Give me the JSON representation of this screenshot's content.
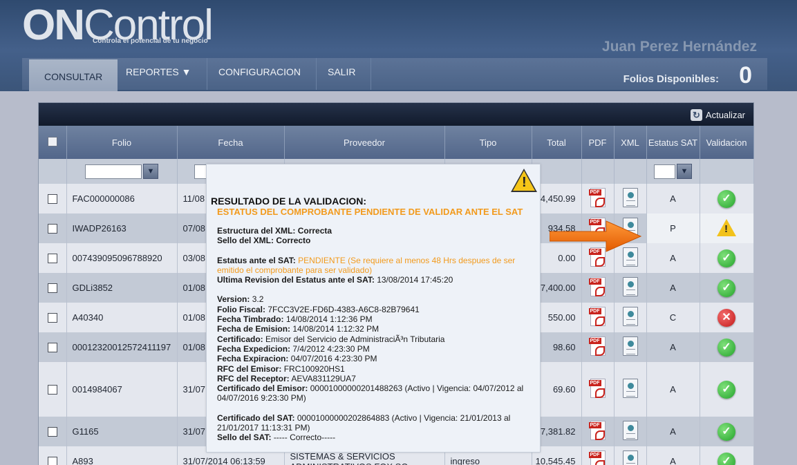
{
  "header": {
    "logo_on": "ON",
    "logo_control": "Control",
    "logo_tagline": "Controla el potencial de tu negocio",
    "user_name": "Juan Perez Hernández",
    "folios_label": "Folios Disponibles:",
    "folios_value": "0"
  },
  "nav": [
    {
      "label": "CONSULTAR"
    },
    {
      "label": "REPORTES ▼"
    },
    {
      "label": "CONFIGURACION"
    },
    {
      "label": "SALIR"
    }
  ],
  "toolbar": {
    "refresh_label": "Actualizar"
  },
  "table": {
    "columns": [
      "Folio",
      "Fecha",
      "Proveedor",
      "Tipo",
      "Total",
      "PDF",
      "XML",
      "Estatus SAT",
      "Validacion"
    ],
    "rows": [
      {
        "folio": "FAC000000086",
        "fecha": "11/08",
        "proveedor": "",
        "tipo": "",
        "total": "4,450.99",
        "estatus": "A",
        "validacion": "ok"
      },
      {
        "folio": "IWADP26163",
        "fecha": "07/08",
        "proveedor": "",
        "tipo": "",
        "total": "934.58",
        "estatus": "P",
        "validacion": "warn"
      },
      {
        "folio": "007439095096788920",
        "fecha": "03/08",
        "proveedor": "",
        "tipo": "",
        "total": "0.00",
        "estatus": "A",
        "validacion": "ok"
      },
      {
        "folio": "GDLi3852",
        "fecha": "01/08",
        "proveedor": "",
        "tipo": "",
        "total": "7,400.00",
        "estatus": "A",
        "validacion": "ok"
      },
      {
        "folio": "A40340",
        "fecha": "01/08",
        "proveedor": "",
        "tipo": "",
        "total": "550.00",
        "estatus": "C",
        "validacion": "error"
      },
      {
        "folio": "0001232001257241119​7",
        "fecha": "01/08",
        "proveedor": "",
        "tipo": "",
        "total": "98.60",
        "estatus": "A",
        "validacion": "ok"
      },
      {
        "folio": "0014984067",
        "fecha": "31/07",
        "proveedor": "",
        "tipo": "",
        "total": "69.60",
        "estatus": "A",
        "validacion": "ok"
      },
      {
        "folio": "G1165",
        "fecha": "31/07",
        "proveedor": "",
        "tipo": "",
        "total": "7,381.82",
        "estatus": "A",
        "validacion": "ok"
      },
      {
        "folio": "A893",
        "fecha": "31/07/2014 06:13:59",
        "proveedor": "SISTEMAS & SERVICIOS ADMINISTRATIVOS FOX SC",
        "tipo": "ingreso",
        "total": "10,545.45",
        "estatus": "A",
        "validacion": "ok"
      }
    ]
  },
  "popup": {
    "title": "RESULTADO DE LA VALIDACION:",
    "subtitle": "ESTATUS DEL COMPROBANTE PENDIENTE DE VALIDAR ANTE EL SAT",
    "estructura_label": "Estructura del XML:",
    "estructura_value": "Correcta",
    "sello_label": "Sello del XML:",
    "sello_value": "Correcto",
    "estatus_label": "Estatus ante el SAT:",
    "estatus_value": "PENDIENTE (Se requiere al menos 48 Hrs despues de ser emitido el comprobante para ser validado)",
    "revision_label": "Ultima Revision del Estatus ante el SAT:",
    "revision_value": "13/08/2014 17:45:20",
    "version_label": "Version:",
    "version_value": "3.2",
    "folio_fiscal_label": "Folio Fiscal:",
    "folio_fiscal_value": "7FCC3V2E-FD6D-4383-A6C8-82B79641",
    "timbrado_label": "Fecha Timbrado:",
    "timbrado_value": "14/08/2014 1:12:36 PM",
    "emision_label": "Fecha de Emision:",
    "emision_value": "14/08/2014 1:12:32 PM",
    "certificado_label": "Certificado:",
    "certificado_value": "Emisor del Servicio de AdministraciÃ³n Tributaria",
    "expedicion_label": "Fecha Expedicion:",
    "expedicion_value": "7/4/2012 4:23:30 PM",
    "expiracion_label": "Fecha Expiracion:",
    "expiracion_value": "04/07/2016 4:23:30 PM",
    "rfc_emisor_label": "RFC del Emisor:",
    "rfc_emisor_value": "FRC100920HS1",
    "rfc_receptor_label": "RFC del Receptor:",
    "rfc_receptor_value": "AEVA831129UA7",
    "cert_emisor_label": "Certificado del Emisor:",
    "cert_emisor_value": "00001000000201488263 (Activo | Vigencia: 04/07/2012 al 04/07/2016 9:23:30 PM)",
    "cert_sat_label": "Certificado del SAT:",
    "cert_sat_value": "00001000000202864883 (Activo | Vigencia: 21/01/2013 al 21/01/2017 11:13:31 PM)",
    "sello_sat_label": "Sello del SAT:",
    "sello_sat_value": "----- Correcto-----"
  },
  "colors": {
    "header_bg": "#3b5579",
    "accent_orange": "#f29a1c",
    "ok_green": "#23a32b",
    "error_red": "#c21a1a",
    "warn_yellow": "#f2c21b"
  },
  "icons": {
    "pdf": "pdf-icon",
    "xml": "xml-icon",
    "ok": "check-circle-icon",
    "error": "x-circle-icon",
    "warn": "warning-triangle-icon",
    "filter": "funnel-icon",
    "refresh": "refresh-icon",
    "arrow": "orange-arrow-icon"
  }
}
